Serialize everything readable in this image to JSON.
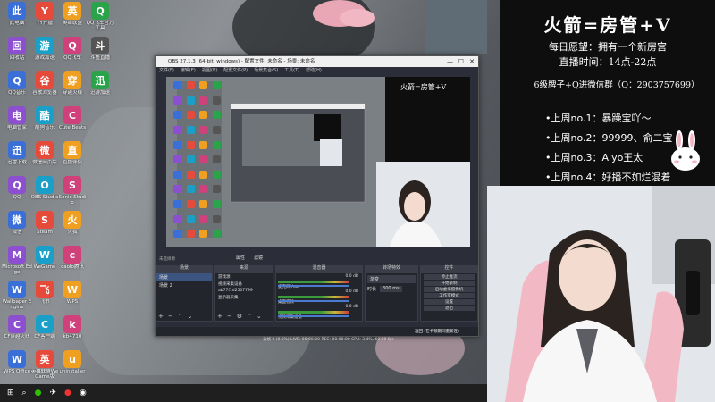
{
  "info_panel": {
    "headline": "火箭=房管+V",
    "wish": "每日愿望：拥有一个新房宫",
    "stream_time": "直播时间：14点-22点",
    "contact": "6级牌子+Q进微信群（Q：2903757699）",
    "ranks": [
      "•上周no.1：暴躁宝吖～",
      "•上周no.2：99999、俞二宝",
      "•上周no.3：Alyo王太",
      "•上周no.4：好播不如烂混着"
    ]
  },
  "desktop_icons": [
    [
      "此电脑",
      "YY开播",
      "英雄联盟",
      "QQ飞车官方工具"
    ],
    [
      "回收站",
      "游戏加速",
      "QQ飞车",
      "斗鱼直播"
    ],
    [
      "QQ音乐",
      "谷歌浏览器",
      "穿越火线",
      "迅游加速"
    ],
    [
      "电脑管家",
      "酷狗音乐",
      "Cute Beats",
      ""
    ],
    [
      "迅雷下载",
      "微信网页版",
      "直播伴侣",
      ""
    ],
    [
      "QQ",
      "OBS Studio",
      "Sonic Studio",
      ""
    ],
    [
      "微信",
      "Steam",
      "火狐",
      ""
    ],
    [
      "Microsoft Edge",
      "WeGame",
      "caolo腾讯",
      ""
    ],
    [
      "Wallpaper Engine",
      "飞书",
      "WPS",
      ""
    ],
    [
      "CF穿越火线",
      "CF客户端",
      "kb4710",
      ""
    ],
    [
      "WPS Office",
      "英雄联盟WeGame版",
      "uninstaller",
      ""
    ]
  ],
  "obs": {
    "title": "OBS 27.1.3 (64-bit, windows) - 配置文件: 未命名 - 场景: 未命名",
    "menu": [
      "文件(F)",
      "编辑(E)",
      "视图(V)",
      "配置文件(P)",
      "场景集合(S)",
      "工具(T)",
      "帮助(H)"
    ],
    "source_toolbar": [
      "属性",
      "滤镜"
    ],
    "status_line": "未选择源",
    "docks": {
      "scenes": "场景",
      "sources": "来源",
      "mixer": "混音器",
      "transitions": "转场特效",
      "controls": "控件"
    },
    "scenes": [
      "场景",
      "场景 2"
    ],
    "sources": [
      "游戏源",
      "视频采集设备",
      "ab77f1d2507799",
      "显示器采集"
    ],
    "mixer_tracks": [
      "麦克风/Aux",
      "桌面音频",
      "视频采集设备"
    ],
    "mixer_levels": [
      "0.0 dB",
      "0.0 dB",
      "0.0 dB"
    ],
    "transition": "渐变",
    "duration_label": "时长",
    "duration": "300 ms",
    "controls": [
      "停止推流",
      "开始录制",
      "启动虚拟摄像机",
      "工作室模式",
      "设置",
      "退出"
    ],
    "status_bar": "丢帧 0 (0.0%)  LIVE: 00:00:00  REC: 00:00:00  CPU: 3.4%, 60.00 fps",
    "hover_text": "返回 (在卡顿期间重新连)"
  },
  "taskbar": {
    "icons": [
      "start-icon",
      "search-icon",
      "wechat-icon",
      "feishu-icon",
      "record-icon",
      "obs-icon"
    ]
  },
  "colors": {
    "obs_bg": "#2b2e38",
    "panel_bg": "#0e0e0f",
    "accent_pink": "#f2a7b6"
  }
}
